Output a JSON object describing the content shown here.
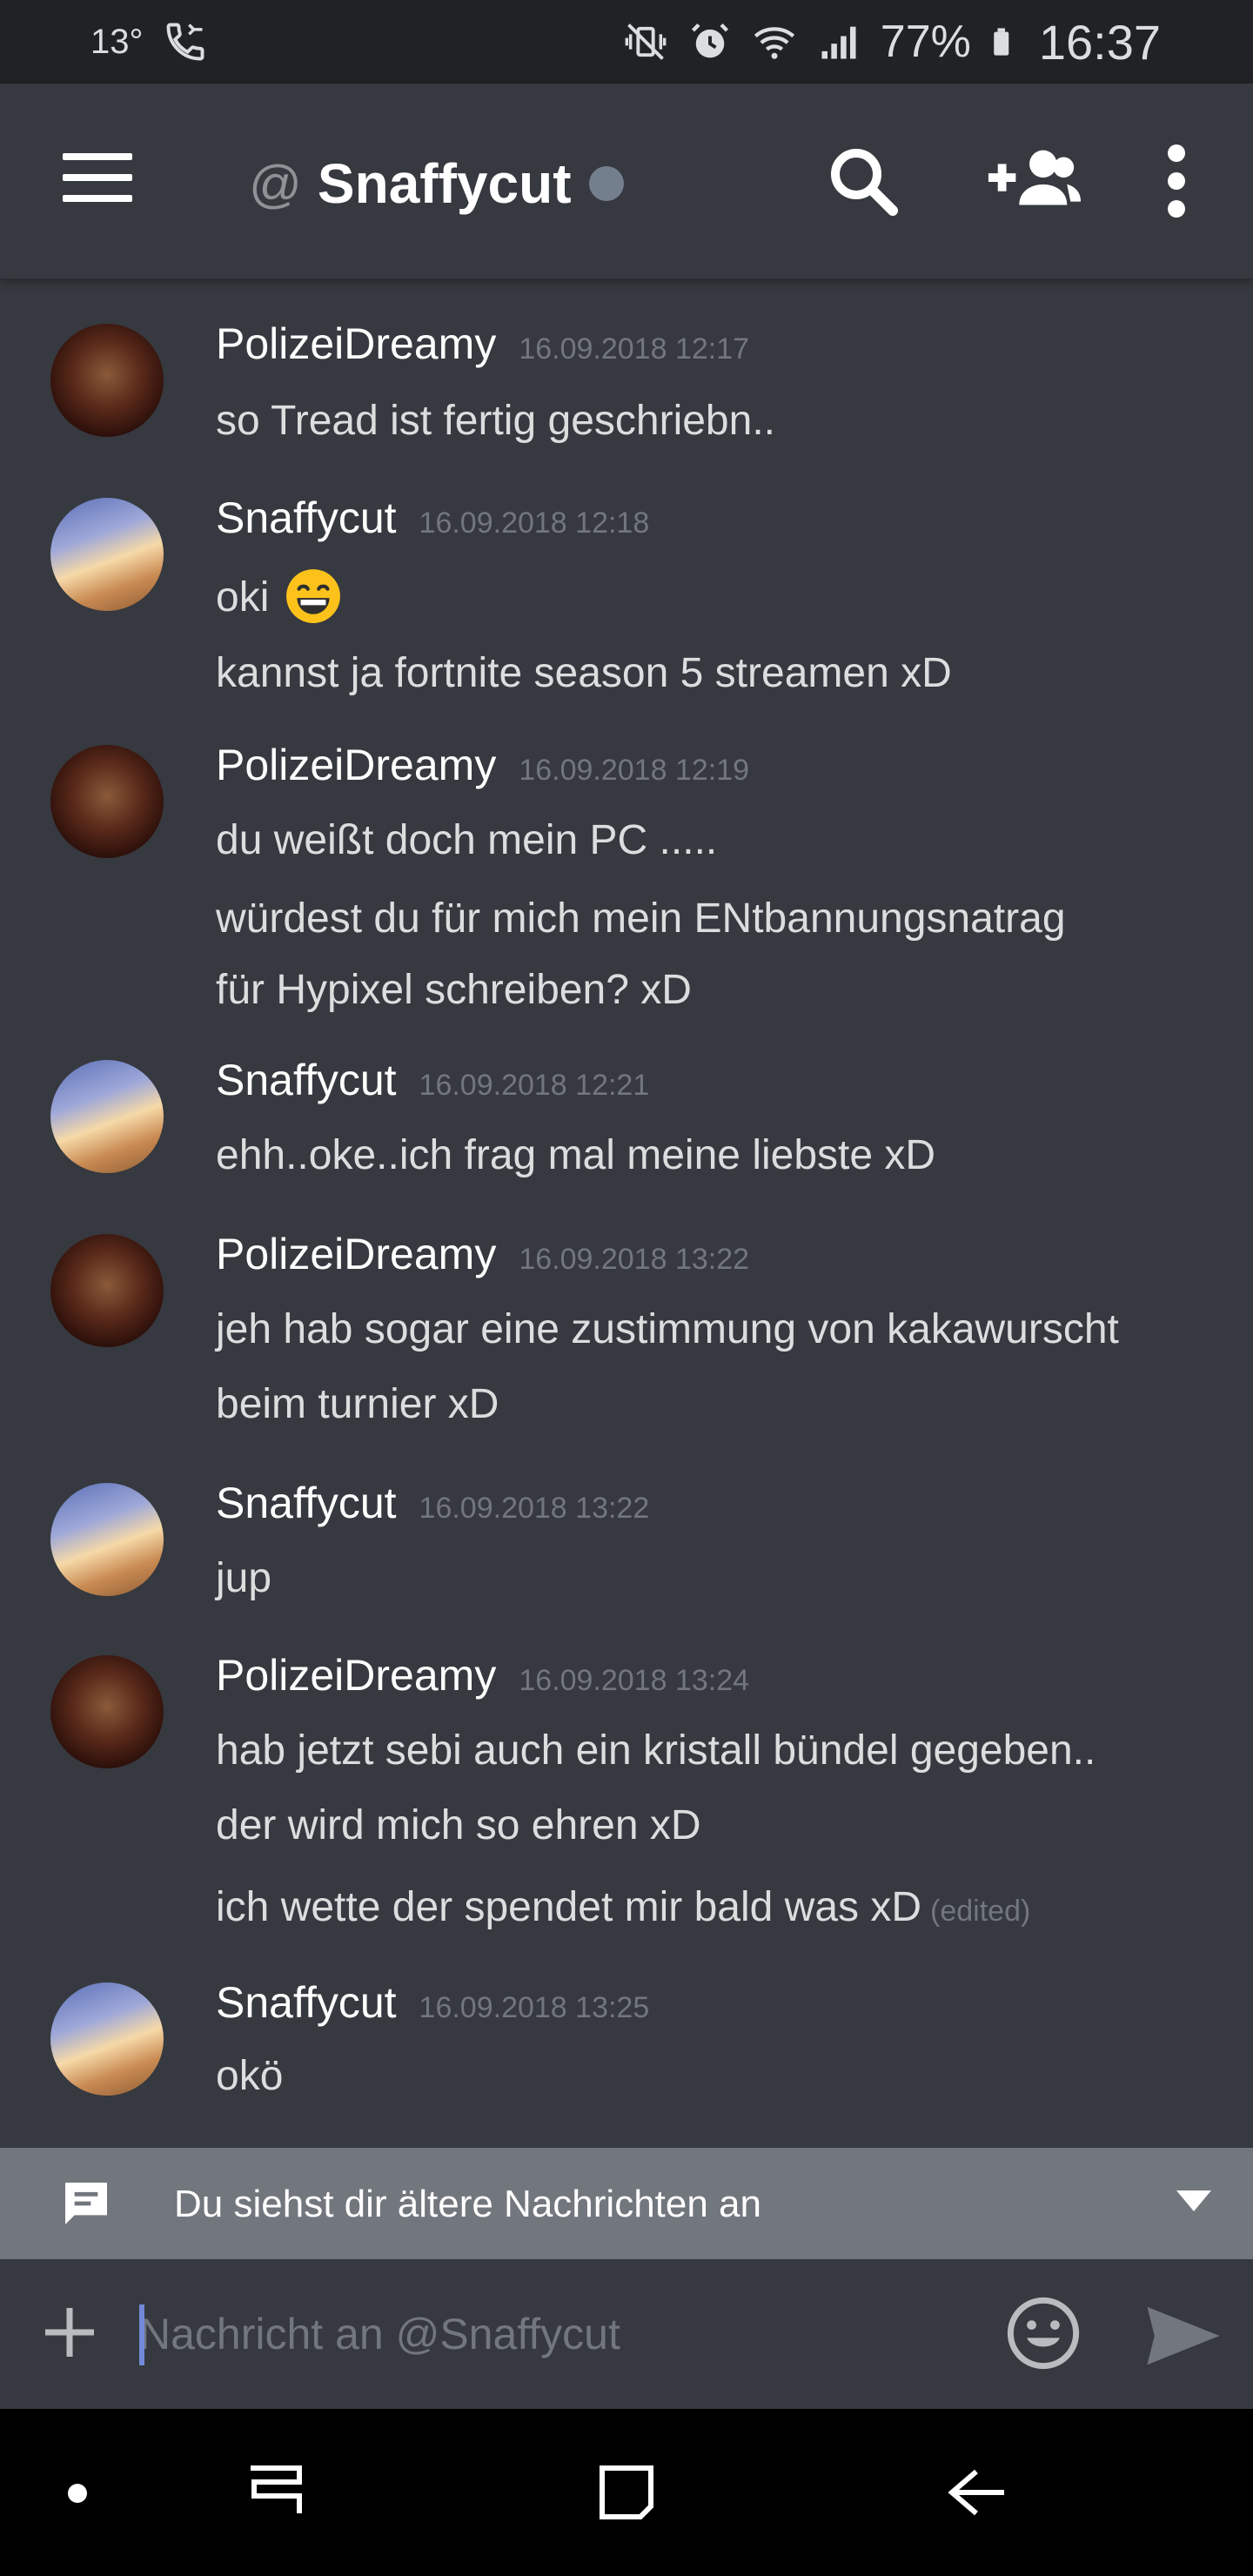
{
  "status_bar": {
    "temperature": "13°",
    "battery_percent": "77%",
    "time": "16:37"
  },
  "header": {
    "at_sign": "@",
    "channel_name": "Snaffycut",
    "status": "offline"
  },
  "messages": [
    {
      "author": "PolizeiDreamy",
      "avatar": "bear",
      "timestamp": "16.09.2018 12:17",
      "lines": [
        "so Tread ist fertig geschriebn.."
      ]
    },
    {
      "author": "Snaffycut",
      "avatar": "sky",
      "timestamp": "16.09.2018 12:18",
      "lines": [
        "oki",
        "kannst ja fortnite season 5 streamen xD"
      ],
      "emoji_after_line_0": "grinning-face"
    },
    {
      "author": "PolizeiDreamy",
      "avatar": "bear",
      "timestamp": "16.09.2018 12:19",
      "lines": [
        "du weißt doch mein PC .....",
        "würdest du für mich mein ENtbannungsnatrag",
        "für Hypixel schreiben? xD"
      ]
    },
    {
      "author": "Snaffycut",
      "avatar": "sky",
      "timestamp": "16.09.2018 12:21",
      "lines": [
        "ehh..oke..ich frag mal meine liebste xD"
      ]
    },
    {
      "author": "PolizeiDreamy",
      "avatar": "bear",
      "timestamp": "16.09.2018 13:22",
      "lines": [
        "jeh hab sogar eine zustimmung von kakawurscht",
        "beim turnier xD"
      ]
    },
    {
      "author": "Snaffycut",
      "avatar": "sky",
      "timestamp": "16.09.2018 13:22",
      "lines": [
        "jup"
      ]
    },
    {
      "author": "PolizeiDreamy",
      "avatar": "bear",
      "timestamp": "16.09.2018 13:24",
      "lines": [
        "hab jetzt sebi auch ein kristall bündel gegeben..",
        "der wird mich so ehren xD",
        "ich wette der spendet mir bald was xD"
      ],
      "edited_label": "(edited)"
    },
    {
      "author": "Snaffycut",
      "avatar": "sky",
      "timestamp": "16.09.2018 13:25",
      "lines": [
        "okö"
      ]
    }
  ],
  "older_banner": {
    "text": "Du siehst dir ältere Nachrichten an"
  },
  "composer": {
    "placeholder": "Nachricht an @Snaffycut",
    "value": ""
  },
  "colors": {
    "background": "#36393f",
    "status_bar": "#202225",
    "banner": "#72767d",
    "accent": "#7289da"
  }
}
